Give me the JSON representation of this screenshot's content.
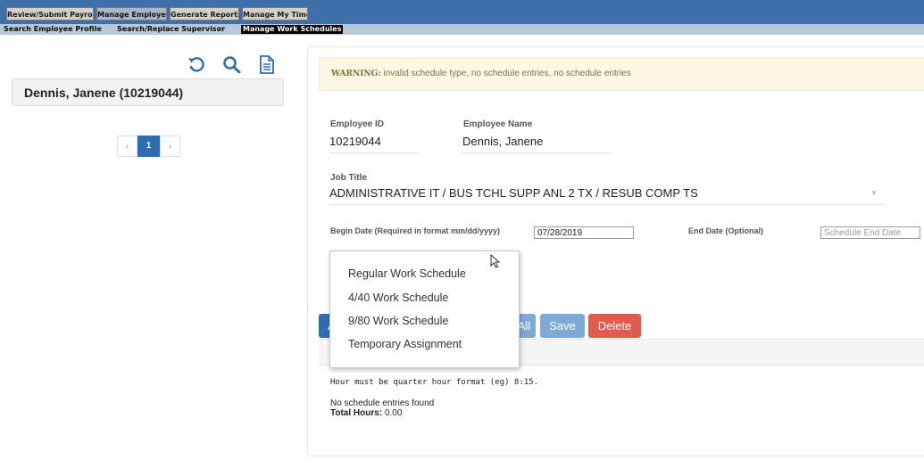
{
  "nav": {
    "tabs": [
      {
        "label": "Review/Submit Payroll"
      },
      {
        "label": "Manage Employee"
      },
      {
        "label": "Generate Reports"
      },
      {
        "label": "Manage My Time"
      }
    ],
    "subtabs": [
      {
        "label": "Search Employee Profile"
      },
      {
        "label": "Search/Replace Supervisor"
      },
      {
        "label": "Manage Work Schedules"
      }
    ],
    "active_tab": "Manage Employee",
    "active_subtab": "Manage Work Schedules"
  },
  "left": {
    "icons": [
      "refresh-icon",
      "search-icon",
      "document-icon"
    ],
    "employee_card": "Dennis, Janene (10219044)",
    "pager": {
      "prev": "‹",
      "current": "1",
      "next": "›"
    }
  },
  "warning": {
    "label": "WARNING:",
    "text": "invalid schedule type, no schedule entries, no schedule entries"
  },
  "form": {
    "employee_id_label": "Employee ID",
    "employee_id": "10219044",
    "employee_name_label": "Employee Name",
    "employee_name": "Dennis, Janene",
    "job_title_label": "Job Title",
    "job_title": "ADMINISTRATIVE IT / BUS TCHL SUPP ANL 2 TX / RESUB COMP TS",
    "begin_date_label": "Begin Date (Required in format mm/dd/yyyy)",
    "begin_date": "07/28/2019",
    "end_date_label": "End Date (Optional)",
    "end_date_placeholder": "Schedule End Date"
  },
  "buttons": {
    "partial_left": "A",
    "partial_all": "All",
    "save": "Save",
    "delete": "Delete"
  },
  "schedule_dropdown": {
    "options": [
      "Regular Work Schedule",
      "4/40 Work Schedule",
      "9/80 Work Schedule",
      "Temporary Assignment"
    ]
  },
  "schedule": {
    "hint": "Hour must be quarter hour format (eg) 8:15.",
    "empty_message": "No schedule entries found",
    "total_label": "Total Hours:",
    "total_value": "0.00"
  },
  "colors": {
    "topbar": "#3f6fa8",
    "primary": "#2f6db3",
    "save": "#7fa9d6",
    "delete": "#e05a4e",
    "warning_bg": "#fcf8e3"
  }
}
